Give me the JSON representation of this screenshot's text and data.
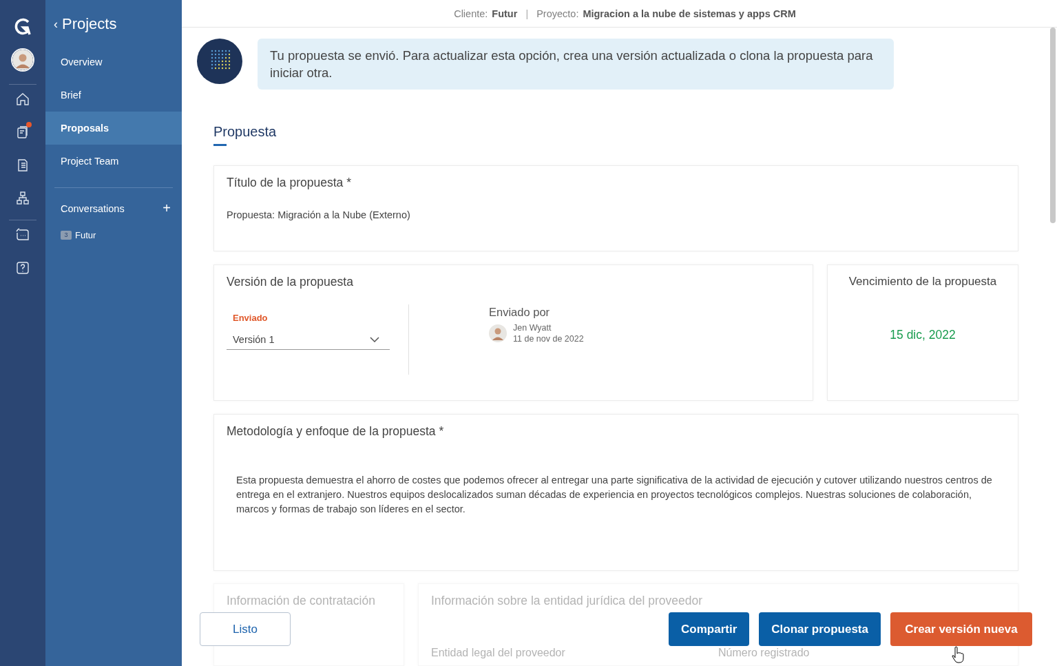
{
  "rail": {
    "groups": [
      [
        {
          "kind": "home",
          "badge": false
        },
        {
          "kind": "documents",
          "badge": true
        },
        {
          "kind": "list",
          "badge": false
        },
        {
          "kind": "hierarchy",
          "badge": false
        }
      ],
      [
        {
          "kind": "chat",
          "badge": false
        },
        {
          "kind": "help",
          "badge": false
        }
      ]
    ]
  },
  "sidebar": {
    "back": "‹",
    "title": "Projects",
    "items": [
      {
        "label": "Overview",
        "selected": false
      },
      {
        "label": "Brief",
        "selected": false
      },
      {
        "label": "Proposals",
        "selected": true
      },
      {
        "label": "Project Team",
        "selected": false
      }
    ],
    "conversations": "Conversations",
    "add": "+",
    "threads": [
      {
        "count": "3",
        "name": "Futur"
      }
    ]
  },
  "header": {
    "client_label": "Cliente:",
    "client": "Futur",
    "separator": "|",
    "project_label": "Proyecto:",
    "project": "Migracion a la nube de sistemas y apps CRM"
  },
  "notice": "Tu propuesta se envió. Para actualizar esta opción, crea una versión actualizada o clona la propuesta para iniciar otra.",
  "tabs": [
    {
      "label": "Propuesta",
      "selected": true
    }
  ],
  "title_card": {
    "heading": "Título de la propuesta *",
    "value": "Propuesta: Migración a la Nube (Externo)"
  },
  "version_card": {
    "heading": "Versión de la propuesta",
    "status": "Enviado",
    "version": "Versión 1",
    "sent_by": "Enviado por",
    "sender": "Jen Wyatt",
    "date": "11 de nov de 2022"
  },
  "expiry_card": {
    "heading": "Vencimiento de la propuesta",
    "date": "15 dic, 2022"
  },
  "methodology": {
    "heading": "Metodología y enfoque de la propuesta *",
    "text": "Esta propuesta demuestra el ahorro de costes que podemos ofrecer al entregar una parte significativa de la actividad de ejecución y cutover utilizando nuestros centros de entrega en el extranjero. Nuestros equipos deslocalizados suman décadas de experiencia en proyectos tecnológicos complejos. Nuestras soluciones de colaboración, marcos y formas de trabajo son líderes en el sector."
  },
  "faded": {
    "contract_heading": "Información de contratación",
    "provider_heading": "Información sobre la entidad jurídica del proveedor",
    "provider_entity": "Entidad legal del proveedor",
    "registered": "Número registrado"
  },
  "buttons": [
    {
      "label": "Listo",
      "kind": "outline"
    },
    {
      "label": "Compartir",
      "kind": "primary"
    },
    {
      "label": "Clonar propuesta",
      "kind": "primary"
    },
    {
      "label": "Crear versión nueva",
      "kind": "accent"
    }
  ]
}
